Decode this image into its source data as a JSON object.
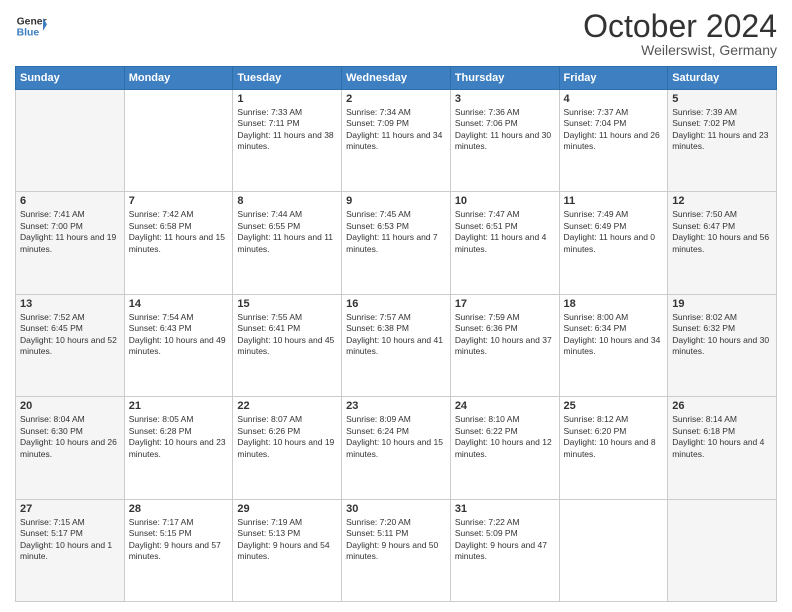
{
  "header": {
    "logo_line1": "General",
    "logo_line2": "Blue",
    "month": "October 2024",
    "location": "Weilerswist, Germany"
  },
  "days_of_week": [
    "Sunday",
    "Monday",
    "Tuesday",
    "Wednesday",
    "Thursday",
    "Friday",
    "Saturday"
  ],
  "weeks": [
    [
      {
        "day": "",
        "info": ""
      },
      {
        "day": "",
        "info": ""
      },
      {
        "day": "1",
        "info": "Sunrise: 7:33 AM\nSunset: 7:11 PM\nDaylight: 11 hours and 38 minutes."
      },
      {
        "day": "2",
        "info": "Sunrise: 7:34 AM\nSunset: 7:09 PM\nDaylight: 11 hours and 34 minutes."
      },
      {
        "day": "3",
        "info": "Sunrise: 7:36 AM\nSunset: 7:06 PM\nDaylight: 11 hours and 30 minutes."
      },
      {
        "day": "4",
        "info": "Sunrise: 7:37 AM\nSunset: 7:04 PM\nDaylight: 11 hours and 26 minutes."
      },
      {
        "day": "5",
        "info": "Sunrise: 7:39 AM\nSunset: 7:02 PM\nDaylight: 11 hours and 23 minutes."
      }
    ],
    [
      {
        "day": "6",
        "info": "Sunrise: 7:41 AM\nSunset: 7:00 PM\nDaylight: 11 hours and 19 minutes."
      },
      {
        "day": "7",
        "info": "Sunrise: 7:42 AM\nSunset: 6:58 PM\nDaylight: 11 hours and 15 minutes."
      },
      {
        "day": "8",
        "info": "Sunrise: 7:44 AM\nSunset: 6:55 PM\nDaylight: 11 hours and 11 minutes."
      },
      {
        "day": "9",
        "info": "Sunrise: 7:45 AM\nSunset: 6:53 PM\nDaylight: 11 hours and 7 minutes."
      },
      {
        "day": "10",
        "info": "Sunrise: 7:47 AM\nSunset: 6:51 PM\nDaylight: 11 hours and 4 minutes."
      },
      {
        "day": "11",
        "info": "Sunrise: 7:49 AM\nSunset: 6:49 PM\nDaylight: 11 hours and 0 minutes."
      },
      {
        "day": "12",
        "info": "Sunrise: 7:50 AM\nSunset: 6:47 PM\nDaylight: 10 hours and 56 minutes."
      }
    ],
    [
      {
        "day": "13",
        "info": "Sunrise: 7:52 AM\nSunset: 6:45 PM\nDaylight: 10 hours and 52 minutes."
      },
      {
        "day": "14",
        "info": "Sunrise: 7:54 AM\nSunset: 6:43 PM\nDaylight: 10 hours and 49 minutes."
      },
      {
        "day": "15",
        "info": "Sunrise: 7:55 AM\nSunset: 6:41 PM\nDaylight: 10 hours and 45 minutes."
      },
      {
        "day": "16",
        "info": "Sunrise: 7:57 AM\nSunset: 6:38 PM\nDaylight: 10 hours and 41 minutes."
      },
      {
        "day": "17",
        "info": "Sunrise: 7:59 AM\nSunset: 6:36 PM\nDaylight: 10 hours and 37 minutes."
      },
      {
        "day": "18",
        "info": "Sunrise: 8:00 AM\nSunset: 6:34 PM\nDaylight: 10 hours and 34 minutes."
      },
      {
        "day": "19",
        "info": "Sunrise: 8:02 AM\nSunset: 6:32 PM\nDaylight: 10 hours and 30 minutes."
      }
    ],
    [
      {
        "day": "20",
        "info": "Sunrise: 8:04 AM\nSunset: 6:30 PM\nDaylight: 10 hours and 26 minutes."
      },
      {
        "day": "21",
        "info": "Sunrise: 8:05 AM\nSunset: 6:28 PM\nDaylight: 10 hours and 23 minutes."
      },
      {
        "day": "22",
        "info": "Sunrise: 8:07 AM\nSunset: 6:26 PM\nDaylight: 10 hours and 19 minutes."
      },
      {
        "day": "23",
        "info": "Sunrise: 8:09 AM\nSunset: 6:24 PM\nDaylight: 10 hours and 15 minutes."
      },
      {
        "day": "24",
        "info": "Sunrise: 8:10 AM\nSunset: 6:22 PM\nDaylight: 10 hours and 12 minutes."
      },
      {
        "day": "25",
        "info": "Sunrise: 8:12 AM\nSunset: 6:20 PM\nDaylight: 10 hours and 8 minutes."
      },
      {
        "day": "26",
        "info": "Sunrise: 8:14 AM\nSunset: 6:18 PM\nDaylight: 10 hours and 4 minutes."
      }
    ],
    [
      {
        "day": "27",
        "info": "Sunrise: 7:15 AM\nSunset: 5:17 PM\nDaylight: 10 hours and 1 minute."
      },
      {
        "day": "28",
        "info": "Sunrise: 7:17 AM\nSunset: 5:15 PM\nDaylight: 9 hours and 57 minutes."
      },
      {
        "day": "29",
        "info": "Sunrise: 7:19 AM\nSunset: 5:13 PM\nDaylight: 9 hours and 54 minutes."
      },
      {
        "day": "30",
        "info": "Sunrise: 7:20 AM\nSunset: 5:11 PM\nDaylight: 9 hours and 50 minutes."
      },
      {
        "day": "31",
        "info": "Sunrise: 7:22 AM\nSunset: 5:09 PM\nDaylight: 9 hours and 47 minutes."
      },
      {
        "day": "",
        "info": ""
      },
      {
        "day": "",
        "info": ""
      }
    ]
  ]
}
